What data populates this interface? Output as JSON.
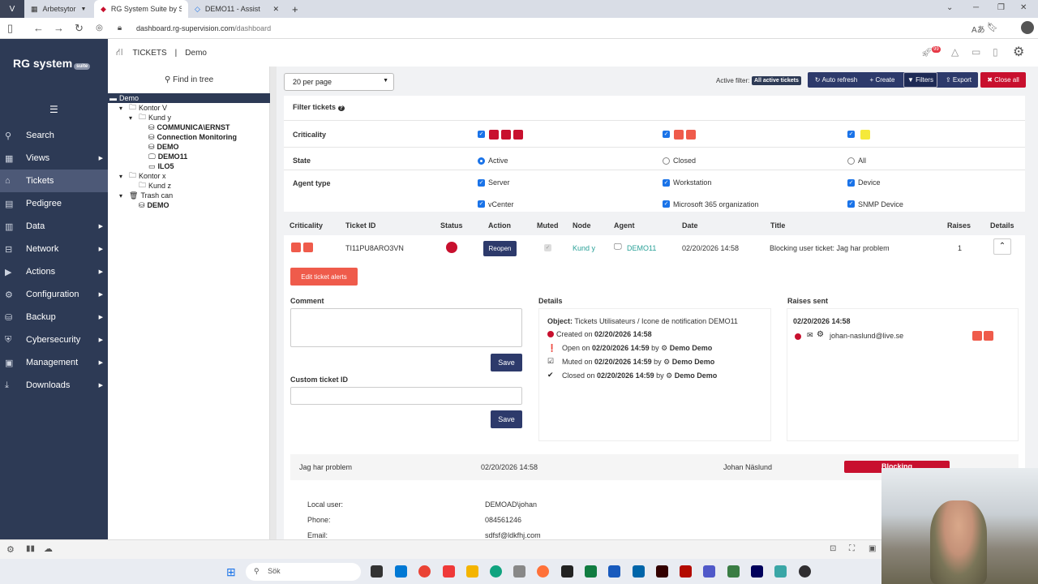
{
  "browser": {
    "tabs": [
      {
        "label": "Arbetsytor"
      },
      {
        "label": "RG System Suite by Septeo"
      },
      {
        "label": "DEMO11 - Assist"
      }
    ],
    "url_host": "dashboard.rg-supervision.com",
    "url_path": "/dashboard"
  },
  "sidebar": {
    "logo": "RG system",
    "logo_badge": "suite",
    "items": [
      {
        "label": "Search",
        "icon": "search-icon",
        "arrow": false
      },
      {
        "label": "Views",
        "icon": "grid-icon",
        "arrow": true
      },
      {
        "label": "Tickets",
        "icon": "tag-icon",
        "arrow": false,
        "active": true
      },
      {
        "label": "Pedigree",
        "icon": "pedigree-icon",
        "arrow": false
      },
      {
        "label": "Data",
        "icon": "chart-icon",
        "arrow": true
      },
      {
        "label": "Network",
        "icon": "network-icon",
        "arrow": true
      },
      {
        "label": "Actions",
        "icon": "play-icon",
        "arrow": true
      },
      {
        "label": "Configuration",
        "icon": "gear-icon",
        "arrow": true
      },
      {
        "label": "Backup",
        "icon": "database-icon",
        "arrow": true
      },
      {
        "label": "Cybersecurity",
        "icon": "shield-icon",
        "arrow": true
      },
      {
        "label": "Management",
        "icon": "briefcase-icon",
        "arrow": true
      },
      {
        "label": "Downloads",
        "icon": "download-icon",
        "arrow": true
      }
    ]
  },
  "topbar": {
    "section": "TICKETS",
    "separator": "|",
    "context": "Demo",
    "notif_count": "99"
  },
  "tree": {
    "find_label": "Find in tree",
    "nodes": [
      {
        "label": "Demo"
      },
      {
        "label": "Kontor V"
      },
      {
        "label": "Kund y"
      },
      {
        "label": "COMMUNICA\\ERNST"
      },
      {
        "label": "Connection Monitoring"
      },
      {
        "label": "DEMO"
      },
      {
        "label": "DEMO11"
      },
      {
        "label": "ILO5"
      },
      {
        "label": "Kontor x"
      },
      {
        "label": "Kund z"
      },
      {
        "label": "Trash can"
      },
      {
        "label": "DEMO"
      }
    ]
  },
  "toolbar": {
    "per_page": "20 per page",
    "active_filter_label": "Active filter:",
    "active_filter_value": "All active tickets",
    "auto_refresh": "Auto refresh",
    "create": "Create",
    "filters": "Filters",
    "export": "Export",
    "close_all": "Close all"
  },
  "filters": {
    "title": "Filter tickets",
    "criticality_label": "Criticality",
    "state_label": "State",
    "state_active": "Active",
    "state_closed": "Closed",
    "state_all": "All",
    "agent_type_label": "Agent type",
    "agent_types": [
      "Server",
      "Workstation",
      "Device",
      "vCenter",
      "Microsoft 365 organization",
      "SNMP Device"
    ]
  },
  "table": {
    "headers": [
      "Criticality",
      "Ticket ID",
      "Status",
      "Action",
      "Muted",
      "Node",
      "Agent",
      "Date",
      "Title",
      "Raises",
      "Details"
    ],
    "row": {
      "ticket_id": "TI11PU8ARO3VN",
      "action": "Reopen",
      "node": "Kund y",
      "agent": "DEMO11",
      "date": "02/20/2026 14:58",
      "title": "Blocking user ticket: Jag har problem",
      "raises": "1"
    }
  },
  "detail": {
    "edit_alerts": "Edit ticket alerts",
    "comment_label": "Comment",
    "save": "Save",
    "custom_id_label": "Custom ticket ID",
    "details_title": "Details",
    "object_label": "Object:",
    "object_value": "Tickets Utilisateurs / Icone de notification DEMO11",
    "created_label": "Created on",
    "created_date": "02/20/2026 14:58",
    "open_label": "Open on",
    "open_date": "02/20/2026 14:59",
    "muted_label": "Muted on",
    "muted_date": "02/20/2026 14:59",
    "closed_label": "Closed on",
    "closed_date": "02/20/2026 14:59",
    "by": "by",
    "by_user": "Demo Demo",
    "raises_title": "Raises sent",
    "raise_date": "02/20/2026 14:58",
    "raise_email": "johan-naslund@live.se"
  },
  "message": {
    "subject": "Jag har problem",
    "date": "02/20/2026 14:58",
    "user": "Johan Näslund",
    "level": "Blocking",
    "local_user_label": "Local user:",
    "local_user": "DEMOAD\\johan",
    "phone_label": "Phone:",
    "phone": "084561246",
    "email_label": "Email:",
    "email": "sdfsf@ldkfhj.com"
  },
  "taskbar": {
    "search": "Sök"
  },
  "colors": {
    "sidebar": "#2d3a55",
    "critical_dark": "#c8102e",
    "critical_orange": "#ef5b4b",
    "critical_yellow": "#f5e93a",
    "blue_button": "#2d3a6b",
    "close_red": "#c8102e"
  }
}
